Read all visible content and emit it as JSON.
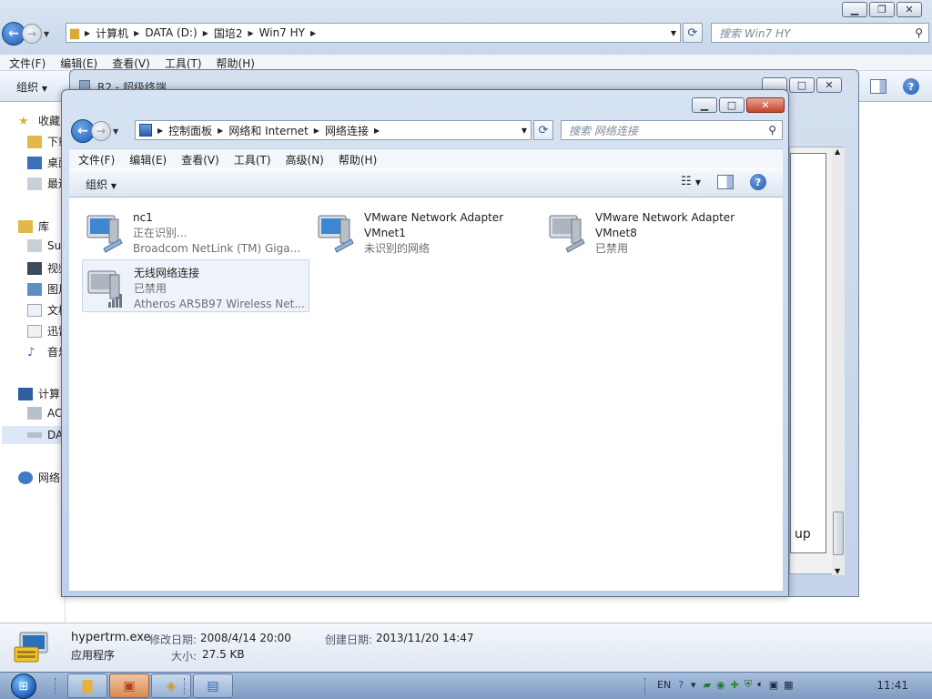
{
  "bg_window": {
    "path": [
      "计算机",
      "DATA (D:)",
      "国培2",
      "Win7 HY"
    ],
    "search_placeholder": "搜索 Win7 HY",
    "menu": [
      "文件(F)",
      "编辑(E)",
      "查看(V)",
      "工具(T)",
      "帮助(H)"
    ],
    "organize": "组织",
    "nav": [
      {
        "label": "收藏",
        "kind": "head"
      },
      {
        "label": "下载",
        "kind": "sub"
      },
      {
        "label": "桌面",
        "kind": "sub"
      },
      {
        "label": "最近",
        "kind": "sub"
      },
      {
        "label": "库",
        "kind": "head"
      },
      {
        "label": "Sul",
        "kind": "sub"
      },
      {
        "label": "视频",
        "kind": "sub"
      },
      {
        "label": "图片",
        "kind": "sub"
      },
      {
        "label": "文档",
        "kind": "sub"
      },
      {
        "label": "迅雷",
        "kind": "sub"
      },
      {
        "label": "音乐",
        "kind": "sub"
      },
      {
        "label": "计算",
        "kind": "head"
      },
      {
        "label": "AC",
        "kind": "sub"
      },
      {
        "label": "DA",
        "kind": "sub-sel"
      },
      {
        "label": "网络",
        "kind": "head"
      }
    ],
    "details": {
      "name": "hypertrm.exe",
      "type": "应用程序",
      "modified_label": "修改日期:",
      "modified_value": "2008/4/14 20:00",
      "size_label": "大小:",
      "size_value": "27.5 KB",
      "created_label": "创建日期:",
      "created_value": "2013/11/20 14:47"
    }
  },
  "ht_window": {
    "title": "R2 - 超级终端",
    "terminal_text": "up"
  },
  "nc_window": {
    "path": [
      "控制面板",
      "网络和 Internet",
      "网络连接"
    ],
    "search_placeholder": "搜索 网络连接",
    "menu": [
      "文件(F)",
      "编辑(E)",
      "查看(V)",
      "工具(T)",
      "高级(N)",
      "帮助(H)"
    ],
    "organize": "组织",
    "connections": [
      {
        "name": "nc1",
        "status": "正在识别...",
        "device": "Broadcom NetLink (TM) Giga...",
        "icon": "wired-network-icon"
      },
      {
        "name": "VMware Network Adapter",
        "status": "VMnet1",
        "device": "未识别的网络",
        "icon": "wired-network-icon"
      },
      {
        "name": "VMware Network Adapter",
        "status": "VMnet8",
        "device": "已禁用",
        "icon": "wired-network-icon"
      },
      {
        "name": "无线网络连接",
        "status": "已禁用",
        "device": "Atheros AR5B97 Wireless Net...",
        "icon": "wireless-network-icon"
      }
    ]
  },
  "taskbar": {
    "lang": "EN",
    "clock": "11:41"
  },
  "colors": {
    "accent": "#1d5bb5",
    "chrome": "#c7d6ea"
  }
}
